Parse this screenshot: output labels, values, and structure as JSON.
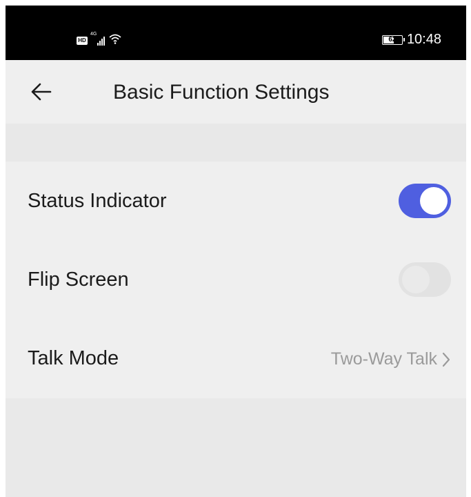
{
  "status_bar": {
    "network_badge": "HD",
    "signal_type": "4G",
    "battery_level": "62",
    "time": "10:48",
    "icons": [
      "hd-icon",
      "signal-icon",
      "wifi-icon",
      "battery-icon"
    ]
  },
  "header": {
    "back_icon": "back-arrow-icon",
    "title": "Basic Function Settings"
  },
  "settings": {
    "status_indicator": {
      "label": "Status Indicator",
      "enabled": true
    },
    "flip_screen": {
      "label": "Flip Screen",
      "enabled": false
    },
    "talk_mode": {
      "label": "Talk Mode",
      "value": "Two-Way Talk",
      "icon": "chevron-right-icon"
    }
  },
  "colors": {
    "accent": "#4f5fe0",
    "toggle_off": "#e2e2e2",
    "background": "#efefef",
    "status_bar": "#000000"
  }
}
